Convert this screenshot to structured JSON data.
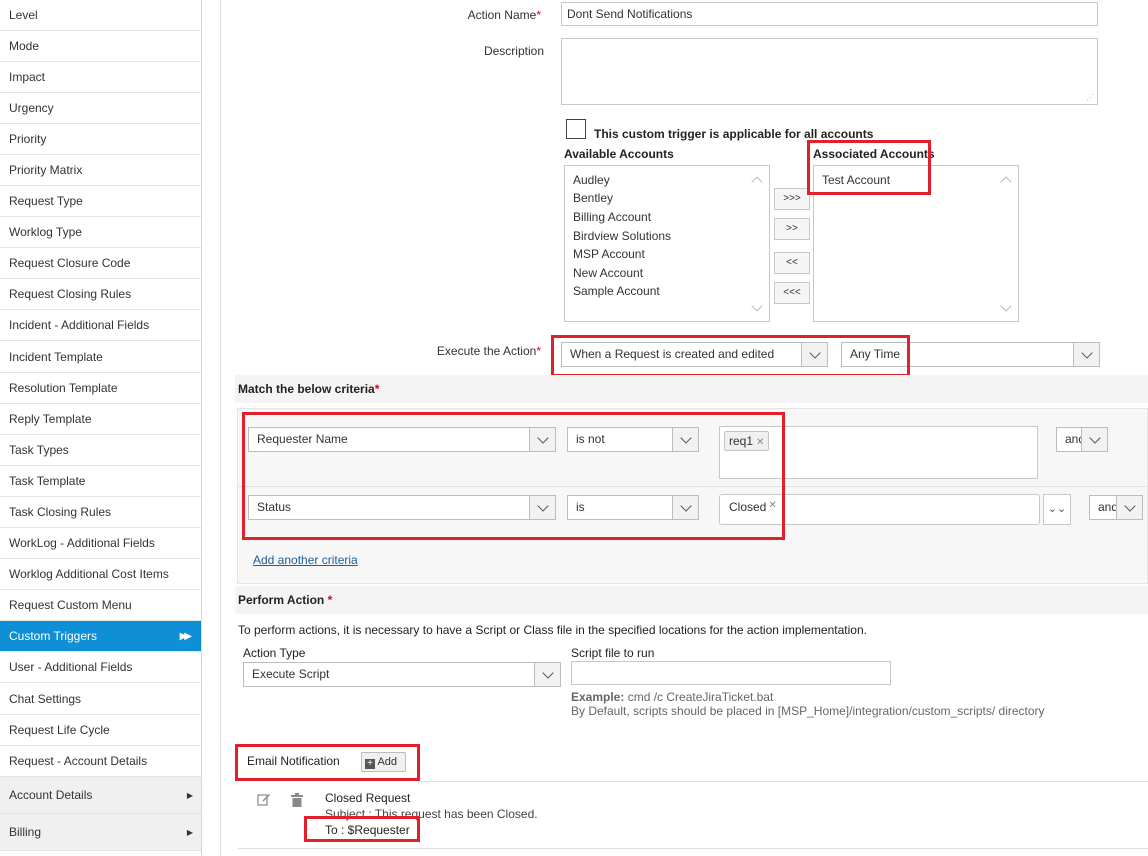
{
  "sidebar": {
    "items": [
      {
        "label": "Level"
      },
      {
        "label": "Mode"
      },
      {
        "label": "Impact"
      },
      {
        "label": "Urgency"
      },
      {
        "label": "Priority"
      },
      {
        "label": "Priority Matrix"
      },
      {
        "label": "Request Type"
      },
      {
        "label": "Worklog Type"
      },
      {
        "label": "Request Closure Code"
      },
      {
        "label": "Request Closing Rules"
      },
      {
        "label": "Incident - Additional Fields"
      },
      {
        "label": "Incident Template"
      },
      {
        "label": "Resolution Template"
      },
      {
        "label": "Reply Template"
      },
      {
        "label": "Task Types"
      },
      {
        "label": "Task Template"
      },
      {
        "label": "Task Closing Rules"
      },
      {
        "label": "WorkLog - Additional Fields"
      },
      {
        "label": "Worklog Additional Cost Items"
      },
      {
        "label": "Request Custom Menu"
      },
      {
        "label": "Custom Triggers",
        "active": true
      },
      {
        "label": "User - Additional Fields"
      },
      {
        "label": "Chat Settings"
      },
      {
        "label": "Request Life Cycle"
      },
      {
        "label": "Request - Account Details"
      }
    ],
    "groups": [
      {
        "label": "Account Details"
      },
      {
        "label": "Billing"
      }
    ]
  },
  "form": {
    "action_name_label": "Action Name",
    "action_name_value": "Dont Send Notifications",
    "description_label": "Description",
    "all_accounts_label": "This custom trigger is applicable for all accounts",
    "available_accounts_label": "Available Accounts",
    "associated_accounts_label": "Associated Accounts",
    "available_accounts": [
      "Audley",
      "Bentley",
      "Billing Account",
      "Birdview Solutions",
      "MSP Account",
      "New Account",
      "Sample Account"
    ],
    "associated_accounts": [
      "Test Account"
    ],
    "move_buttons": [
      ">>>",
      ">>",
      "<<",
      "<<<"
    ],
    "execute_label": "Execute the Action",
    "execute_event": "When a Request is created and edited",
    "execute_time": "Any Time"
  },
  "criteria": {
    "section_label": "Match the below criteria",
    "rows": [
      {
        "field": "Requester Name",
        "operator": "is not",
        "value": "req1",
        "conjunction": "and"
      },
      {
        "field": "Status",
        "operator": "is",
        "value": "Closed",
        "conjunction": "and"
      }
    ],
    "add_link": "Add another criteria"
  },
  "perform": {
    "section_label": "Perform Action",
    "info": "To perform actions, it is necessary to have a Script or Class file in the specified locations for the action implementation.",
    "action_type_label": "Action Type",
    "action_type_value": "Execute Script",
    "script_label": "Script file to run",
    "example_label": "Example:",
    "example_value": "cmd /c CreateJiraTicket.bat",
    "default_note": "By Default, scripts should be placed in [MSP_Home]/integration/custom_scripts/ directory"
  },
  "email": {
    "section_label": "Email Notification",
    "add_label": "Add",
    "notification_title": "Closed Request",
    "notification_subject": "Subject : This request has been Closed.",
    "notification_to": "To : $Requester"
  },
  "colors": {
    "accent": "#0e8fd6",
    "highlight": "#e0202a",
    "required": "#d0021b",
    "link": "#1a5f9e"
  }
}
